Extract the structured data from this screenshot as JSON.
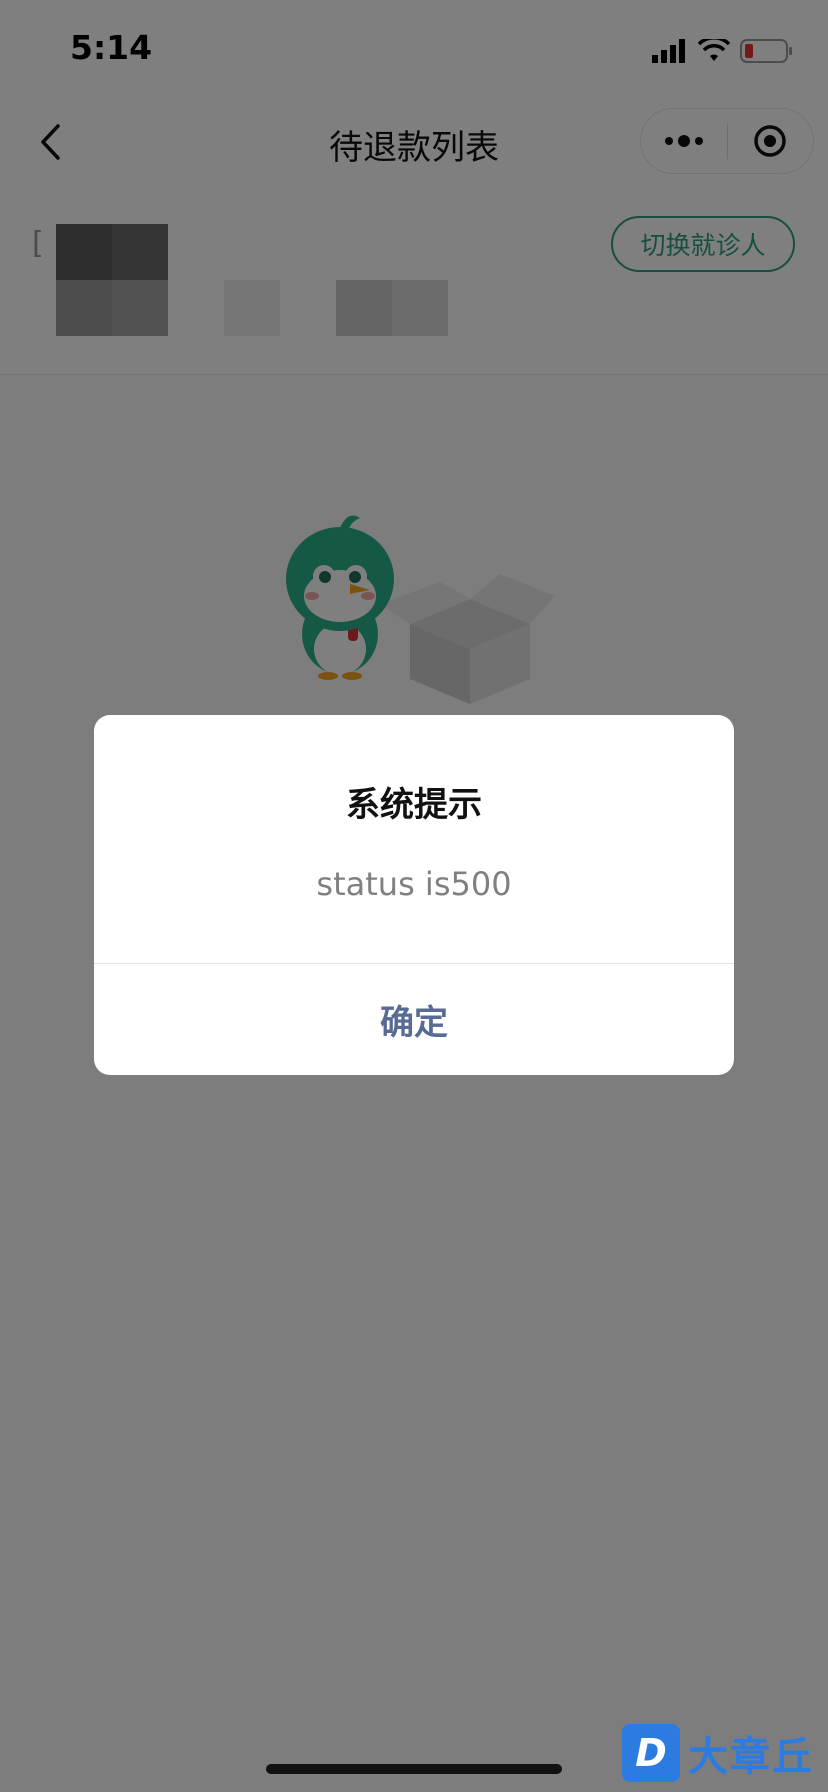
{
  "status_bar": {
    "time": "5:14"
  },
  "nav": {
    "title": "待退款列表"
  },
  "patient": {
    "bracket": "[",
    "switch_label": "切换就诊人"
  },
  "dialog": {
    "title": "系统提示",
    "message": "status is500",
    "confirm_label": "确定"
  },
  "watermark": {
    "logo_letter": "D",
    "text": "大章丘"
  },
  "colors": {
    "accent": "#2e9d82",
    "link": "#576b95",
    "mask": "rgba(0,0,0,0.5)"
  }
}
